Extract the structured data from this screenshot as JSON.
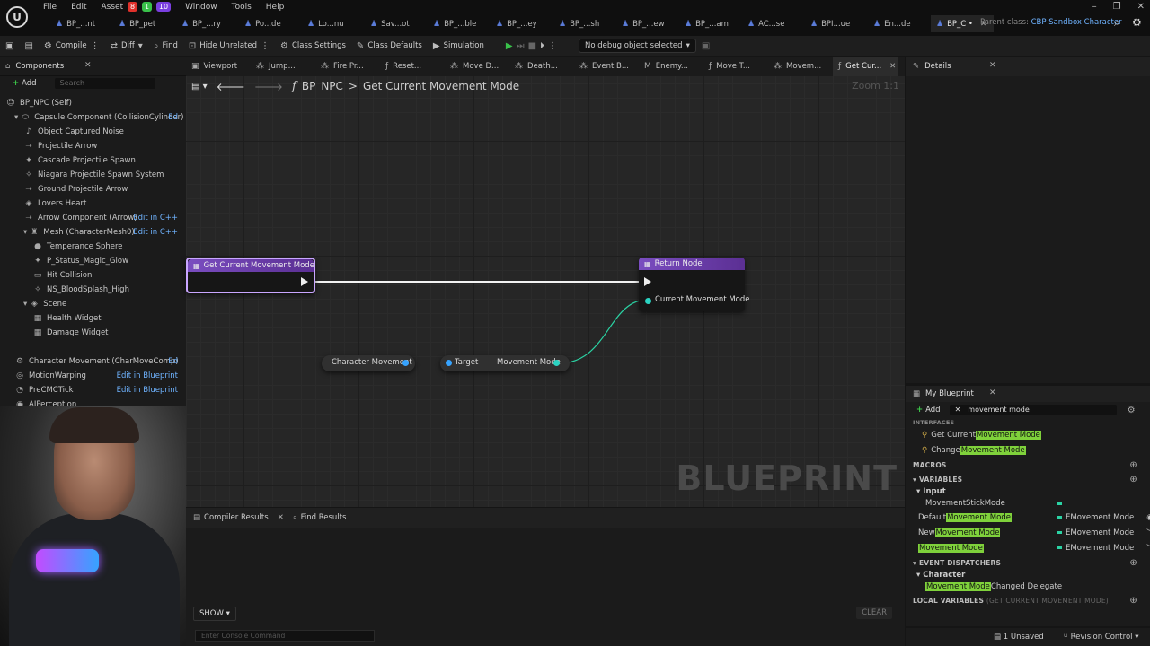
{
  "menu": {
    "items": [
      "File",
      "Edit",
      "Asset",
      "Window",
      "Tools",
      "Help"
    ],
    "badges": [
      {
        "label": "8",
        "color": "#e0312b"
      },
      {
        "label": "1",
        "color": "#39c14a"
      },
      {
        "label": "10",
        "color": "#7a3fe0"
      }
    ]
  },
  "file_tabs": [
    {
      "label": "BP_...nt",
      "active": false
    },
    {
      "label": "BP_pet",
      "active": false
    },
    {
      "label": "BP_...ry",
      "active": false
    },
    {
      "label": "Po...de",
      "active": false
    },
    {
      "label": "Lo...nu",
      "active": false
    },
    {
      "label": "Sav...ot",
      "active": false
    },
    {
      "label": "BP_...ble",
      "active": false
    },
    {
      "label": "BP_...ey",
      "active": false
    },
    {
      "label": "BP_...sh",
      "active": false
    },
    {
      "label": "BP_...ew",
      "active": false
    },
    {
      "label": "BP_...am",
      "active": false
    },
    {
      "label": "AC...se",
      "active": false
    },
    {
      "label": "BPI...ue",
      "active": false
    },
    {
      "label": "En...de",
      "active": false
    },
    {
      "label": "BP_C •",
      "active": true
    }
  ],
  "parent_class": {
    "label": "Parent class:",
    "value": "CBP Sandbox Character"
  },
  "toolbar": {
    "compile": "Compile",
    "diff": "Diff",
    "find": "Find",
    "hide_unrelated": "Hide Unrelated",
    "class_settings": "Class Settings",
    "class_defaults": "Class Defaults",
    "simulation": "Simulation",
    "debug_object": "No debug object selected"
  },
  "components": {
    "title": "Components",
    "add_label": "Add",
    "search_placeholder": "Search",
    "tree": [
      {
        "label": "BP_NPC (Self)",
        "indent": 0,
        "icon": "person-icon",
        "edit": ""
      },
      {
        "label": "Capsule Component (CollisionCylinder)",
        "indent": 1,
        "icon": "capsule-icon",
        "edit": "Ed"
      },
      {
        "label": "Object Captured Noise",
        "indent": 2,
        "icon": "audio-icon",
        "edit": ""
      },
      {
        "label": "Projectile Arrow",
        "indent": 2,
        "icon": "arrow-icon",
        "edit": ""
      },
      {
        "label": "Cascade Projectile Spawn",
        "indent": 2,
        "icon": "particle-icon",
        "edit": ""
      },
      {
        "label": "Niagara Projectile Spawn System",
        "indent": 2,
        "icon": "niagara-icon",
        "edit": ""
      },
      {
        "label": "Ground Projectile Arrow",
        "indent": 2,
        "icon": "arrow-icon",
        "edit": ""
      },
      {
        "label": "Lovers Heart",
        "indent": 2,
        "icon": "scene-icon",
        "edit": ""
      },
      {
        "label": "Arrow Component (Arrow)",
        "indent": 2,
        "icon": "arrow-icon",
        "edit": "Edit in C++"
      },
      {
        "label": "Mesh (CharacterMesh0)",
        "indent": 2,
        "icon": "mesh-icon",
        "edit": "Edit in C++"
      },
      {
        "label": "Temperance Sphere",
        "indent": 3,
        "icon": "sphere-icon",
        "edit": ""
      },
      {
        "label": "P_Status_Magic_Glow",
        "indent": 3,
        "icon": "particle-icon",
        "edit": ""
      },
      {
        "label": "Hit Collision",
        "indent": 3,
        "icon": "collision-icon",
        "edit": ""
      },
      {
        "label": "NS_BloodSplash_High",
        "indent": 3,
        "icon": "niagara-icon",
        "edit": ""
      },
      {
        "label": "Scene",
        "indent": 2,
        "icon": "scene-icon",
        "edit": ""
      },
      {
        "label": "Health Widget",
        "indent": 3,
        "icon": "widget-icon",
        "edit": ""
      },
      {
        "label": "Damage Widget",
        "indent": 3,
        "icon": "widget-icon",
        "edit": ""
      },
      {
        "label": "",
        "indent": 0,
        "icon": "",
        "edit": ""
      },
      {
        "label": "Character Movement (CharMoveComp)",
        "indent": 1,
        "icon": "movement-icon",
        "edit": "Ed"
      },
      {
        "label": "MotionWarping",
        "indent": 1,
        "icon": "motion-icon",
        "edit": "Edit in Blueprint"
      },
      {
        "label": "PreCMCTick",
        "indent": 1,
        "icon": "tick-icon",
        "edit": "Edit in Blueprint"
      },
      {
        "label": "AIPerception",
        "indent": 1,
        "icon": "eye-icon",
        "edit": ""
      }
    ]
  },
  "graph_tabs": [
    {
      "label": "Viewport",
      "active": false
    },
    {
      "label": "Jump...",
      "active": false
    },
    {
      "label": "Fire Pr...",
      "active": false
    },
    {
      "label": "Reset...",
      "active": false
    },
    {
      "label": "Move D...",
      "active": false
    },
    {
      "label": "Death...",
      "active": false
    },
    {
      "label": "Event B...",
      "active": false
    },
    {
      "label": "Enemy...",
      "active": false
    },
    {
      "label": "Move T...",
      "active": false
    },
    {
      "label": "Movem...",
      "active": false
    },
    {
      "label": "Get Cur...",
      "active": true
    }
  ],
  "graph": {
    "breadcrumb_root": "BP_NPC",
    "breadcrumb_sep": ">",
    "breadcrumb_fn": "Get Current Movement Mode",
    "zoom": "Zoom 1:1",
    "watermark": "BLUEPRINT",
    "entry_node": "Get Current Movement Mode",
    "return_node": "Return Node",
    "return_pin": "Current Movement Mode",
    "charmove_node": "Character Movement",
    "target_pin": "Target",
    "movement_mode_pin": "Movement Mode"
  },
  "bottom": {
    "compiler_results": "Compiler Results",
    "find_results": "Find Results",
    "show": "SHOW",
    "clear": "CLEAR",
    "console_placeholder": "Enter Console Command"
  },
  "details": {
    "title": "Details"
  },
  "my_blueprint": {
    "title": "My Blueprint",
    "add_label": "Add",
    "search_value": "movement mode",
    "sections": {
      "interfaces": "INTERFACES",
      "macros": "MACROS",
      "variables": "VARIABLES",
      "event_dispatchers": "EVENT DISPATCHERS",
      "local_variables": "LOCAL VARIABLES",
      "local_variables_sub": "(GET CURRENT MOVEMENT MODE)"
    },
    "interface_items": [
      {
        "prefix": "Get Current ",
        "highlight": "Movement Mode",
        "suffix": ""
      },
      {
        "prefix": "Change ",
        "highlight": "Movement Mode",
        "suffix": ""
      }
    ],
    "variable_category": "Input",
    "variables": [
      {
        "prefix": "MovementStickMode",
        "highlight": "",
        "suffix": "",
        "type": ""
      },
      {
        "prefix": "Default ",
        "highlight": "Movement Mode",
        "suffix": "",
        "type": "EMovement Mode"
      },
      {
        "prefix": "New ",
        "highlight": "Movement Mode",
        "suffix": "",
        "type": "EMovement Mode"
      },
      {
        "prefix": "",
        "highlight": "Movement Mode",
        "suffix": "",
        "type": "EMovement Mode"
      }
    ],
    "dispatcher_category": "Character",
    "dispatchers": [
      {
        "prefix": "",
        "highlight": "Movement Mode",
        "suffix": " Changed Delegate"
      }
    ]
  },
  "status": {
    "unsaved": "1 Unsaved",
    "revision": "Revision Control"
  },
  "colors": {
    "accent_green": "#7fd13b",
    "link_blue": "#6fb3ff",
    "pin_teal": "#2bd3c2",
    "node_header_purple": "#7a4dc0"
  }
}
